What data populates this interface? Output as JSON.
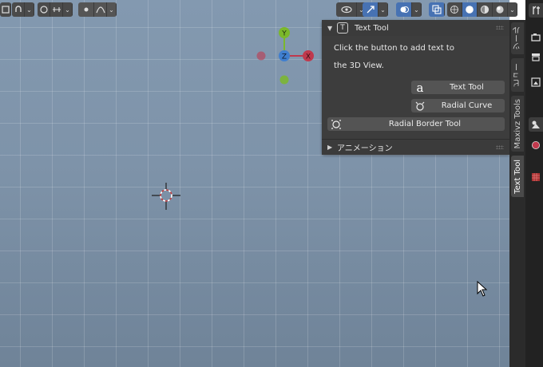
{
  "header": {
    "icons": [
      "transform-pivot-icon",
      "snap-icon",
      "proportional-edit-icon",
      "falloff-icon",
      "visibility-icon",
      "gizmo-icon",
      "overlay-icon",
      "xray-icon",
      "shading-wireframe-icon",
      "shading-solid-icon",
      "shading-material-icon",
      "shading-rendered-icon"
    ]
  },
  "gizmo": {
    "y_label": "Y",
    "z_label": "Z",
    "x_label": "X",
    "colors": {
      "x": "#c0394d",
      "y": "#7bb82b",
      "z": "#3f7fd0"
    }
  },
  "panel": {
    "title": "Text Tool",
    "title_icon": "T",
    "description_line1": "Click the button to add text to",
    "description_line2": "the 3D View.",
    "buttons": [
      {
        "label": "Text Tool",
        "icon": "a"
      },
      {
        "label": "Radial Curve",
        "icon": "radial-curve-icon"
      },
      {
        "label": "Radial Border Tool",
        "icon": "radial-border-icon"
      }
    ],
    "subpanel_title": "アニメーション"
  },
  "sidebar": {
    "tabs": [
      "ツール",
      "ビュー",
      "Maxivz Tools",
      "Text Tool"
    ],
    "active_tab": "Text Tool"
  },
  "properties": {
    "icons": [
      "tool-icon",
      "render-icon",
      "output-icon",
      "view-layer-icon",
      "scene-icon",
      "world-icon",
      "texture-icon"
    ]
  },
  "colors": {
    "accent": "#4772b3",
    "viewport": "#8fa3b8",
    "panel": "#3d3d3d"
  }
}
